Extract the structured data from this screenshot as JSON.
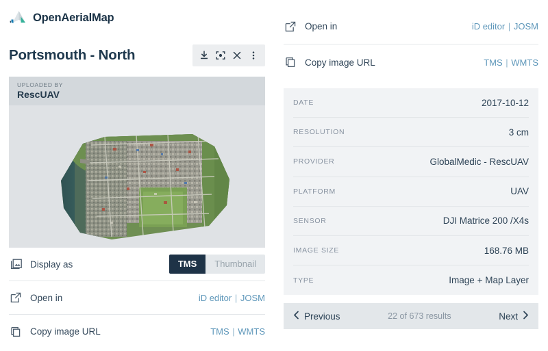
{
  "brand": {
    "name": "OpenAerialMap",
    "logo_icon": "openaerialmap-logo-icon"
  },
  "left": {
    "title": "Portsmouth - North",
    "actions": [
      {
        "name": "download-icon",
        "label": "Download"
      },
      {
        "name": "fit-to-view-icon",
        "label": "Fit to view"
      },
      {
        "name": "close-icon",
        "label": "Close"
      },
      {
        "name": "more-options-icon",
        "label": "More options"
      }
    ],
    "uploaded_by_label": "UPLOADED BY",
    "uploaded_by_value": "RescUAV",
    "image_alt": "Aerial imagery of Portsmouth - North coastal town",
    "rows": [
      {
        "icon": "image-stack-icon",
        "label": "Display as",
        "control": "toggle",
        "options": [
          "TMS",
          "Thumbnail"
        ],
        "selected": "TMS"
      },
      {
        "icon": "external-link-icon",
        "label": "Open in",
        "control": "links",
        "links": [
          "iD editor",
          "JOSM"
        ],
        "separator": "|"
      },
      {
        "icon": "copy-icon",
        "label": "Copy image URL",
        "control": "links",
        "links": [
          "TMS",
          "WMTS"
        ],
        "separator": "|"
      }
    ]
  },
  "right": {
    "rows": [
      {
        "icon": "external-link-icon",
        "label": "Open in",
        "links": [
          "iD editor",
          "JOSM"
        ],
        "separator": "|"
      },
      {
        "icon": "copy-icon",
        "label": "Copy image URL",
        "links": [
          "TMS",
          "WMTS"
        ],
        "separator": "|"
      }
    ],
    "metadata": [
      {
        "key": "DATE",
        "value": "2017-10-12"
      },
      {
        "key": "RESOLUTION",
        "value": "3 cm"
      },
      {
        "key": "PROVIDER",
        "value": "GlobalMedic - RescUAV"
      },
      {
        "key": "PLATFORM",
        "value": "UAV"
      },
      {
        "key": "SENSOR",
        "value": "DJI Matrice 200 /X4s"
      },
      {
        "key": "IMAGE SIZE",
        "value": "168.76 MB"
      },
      {
        "key": "TYPE",
        "value": "Image + Map Layer"
      }
    ],
    "pagination": {
      "previous": "Previous",
      "next": "Next",
      "count_text": "22 of 673 results",
      "prev_icon": "chevron-left-icon",
      "next_icon": "chevron-right-icon"
    }
  },
  "colors": {
    "accent_dark": "#1e3347",
    "link": "#5e97ba",
    "uploaded_band": "#d3d8dc",
    "meta_bg": "#f1f3f5",
    "pager_bg": "#e3e7ea"
  }
}
